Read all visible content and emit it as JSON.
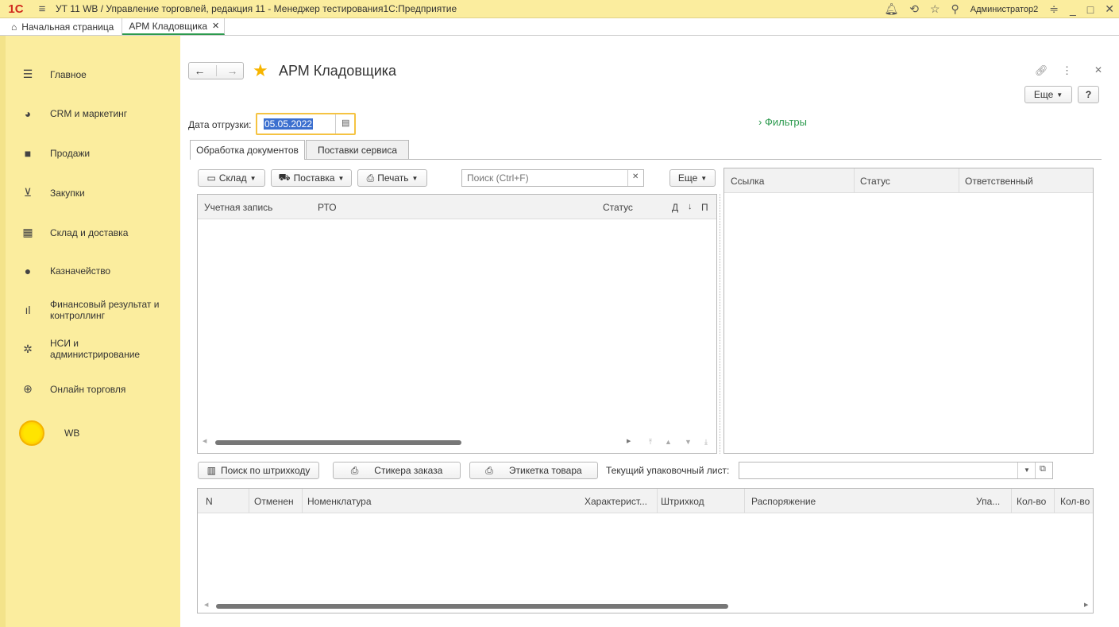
{
  "titlebar": {
    "logo": "1С",
    "title": "УТ 11 WB / Управление торговлей, редакция 11  - Менеджер тестирования1С:Предприятие",
    "user": "Администратор2"
  },
  "tabs": {
    "home": "Начальная страница",
    "active": "АРМ Кладовщика"
  },
  "sidebar": {
    "items": [
      {
        "label": "Главное",
        "icon": "menu-icon"
      },
      {
        "label": "CRM и маркетинг",
        "icon": "pie-chart-icon"
      },
      {
        "label": "Продажи",
        "icon": "bag-icon"
      },
      {
        "label": "Закупки",
        "icon": "cart-icon"
      },
      {
        "label": "Склад и доставка",
        "icon": "warehouse-icon"
      },
      {
        "label": "Казначейство",
        "icon": "ruble-icon"
      },
      {
        "label": "Финансовый результат и контроллинг",
        "icon": "bar-chart-icon"
      },
      {
        "label": "НСИ и администрирование",
        "icon": "gear-icon"
      },
      {
        "label": "Онлайн торговля",
        "icon": "globe-icon"
      },
      {
        "label": "WB",
        "icon": "wb-circle-icon"
      }
    ]
  },
  "page": {
    "title": "АРМ Кладовщика",
    "more": "Еще",
    "help": "?",
    "date_label": "Дата отгрузки:",
    "date_value": "05.05.2022",
    "filters": "Фильтры"
  },
  "doc_tabs": [
    "Обработка документов",
    "Поставки сервиса"
  ],
  "toolbar": {
    "sklad": "Склад",
    "postavka": "Поставка",
    "pechat": "Печать",
    "search_placeholder": "Поиск (Ctrl+F)",
    "more": "Еще"
  },
  "left_table": {
    "columns": [
      "Учетная запись",
      "РТО",
      "Статус",
      "Д",
      "П"
    ]
  },
  "right_table": {
    "columns": [
      "Ссылка",
      "Статус",
      "Ответственный"
    ]
  },
  "bottom_toolbar": {
    "barcode_search": "Поиск по штрихкоду",
    "order_stickers": "Стикера заказа",
    "product_label": "Этикетка товара",
    "packing_label": "Текущий упаковочный лист:"
  },
  "bottom_table": {
    "columns": [
      "N",
      "Отменен",
      "Номенклатура",
      "Характерист...",
      "Штрихкод",
      "Распоряжение",
      "Упа...",
      "Кол-во",
      "Кол-во"
    ]
  },
  "colors": {
    "sidebar_bg": "#fbed9e",
    "accent_green": "#2c9a4e",
    "star": "#f7b500"
  }
}
